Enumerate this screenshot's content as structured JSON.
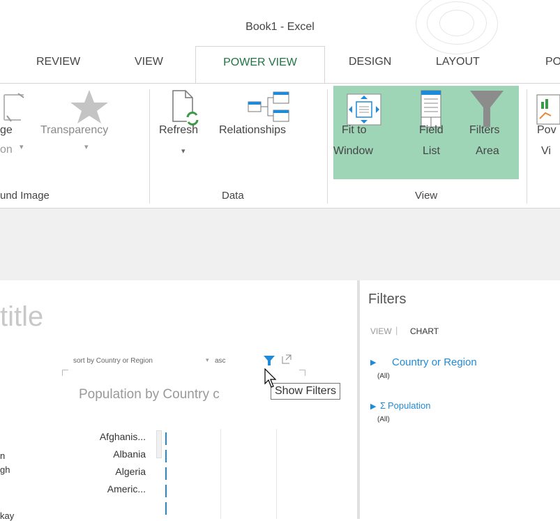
{
  "window": {
    "title": "Book1 - Excel"
  },
  "tabs": {
    "review": "REVIEW",
    "view": "VIEW",
    "power_view": "POWER VIEW",
    "design": "DESIGN",
    "layout": "LAYOUT",
    "partial_next": "PO"
  },
  "ribbon": {
    "background_group": {
      "set_image_partial": "ge",
      "position_partial": "on",
      "transparency": "Transparency",
      "group_label_partial": "und Image"
    },
    "data_group": {
      "refresh": "Refresh",
      "relationships": "Relationships",
      "group_label": "Data"
    },
    "view_group": {
      "fit_to_window_line1": "Fit to",
      "fit_to_window_line2": "Window",
      "field_list_line1": "Field",
      "field_list_line2": "List",
      "filters_area_line1": "Filters",
      "filters_area_line2": "Area",
      "group_label": "View"
    },
    "next_group_partial_line1": "Pov",
    "next_group_partial_line2": "Vi"
  },
  "canvas": {
    "title_placeholder": "title",
    "sort_text": "sort by  Country or Region",
    "sort_order": "asc",
    "chart_title": "Population by Country c",
    "tooltip": "Show Filters",
    "countries": [
      "Afghanis...",
      "Albania",
      "Algeria",
      "Americ..."
    ],
    "left_partial_labels": [
      "n",
      "gh",
      "kay"
    ],
    "bar_color": "#1f8ad7"
  },
  "filters_pane": {
    "title": "Filters",
    "tab_view": "VIEW",
    "tab_chart": "CHART",
    "fields": [
      {
        "name": "Country or Region",
        "value": "(All)"
      },
      {
        "name": "Population",
        "value": "(All)"
      }
    ]
  },
  "colors": {
    "accent_green": "#217346",
    "view_group_highlight": "#9fd5b7",
    "link_blue": "#1f8ad7"
  }
}
